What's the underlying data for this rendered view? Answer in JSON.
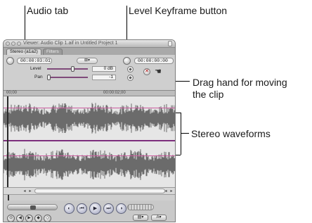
{
  "callouts": {
    "audio_tab": "Audio tab",
    "level_keyframe_button": "Level Keyframe button",
    "drag_hand_line1": "Drag hand for moving",
    "drag_hand_line2": "the clip",
    "stereo_waveforms": "Stereo waveforms"
  },
  "window": {
    "title": "Viewer: Audio Clip 1.aif in Untitled Project 1"
  },
  "tabs": [
    {
      "label": "Stereo (a1a2)",
      "active": true
    },
    {
      "label": "Filters",
      "active": false
    }
  ],
  "timecode": {
    "duration": "00:00:03:01",
    "current": "00:00:00:00"
  },
  "params": {
    "level": {
      "label": "Level",
      "value": "0",
      "unit": "dB"
    },
    "pan": {
      "label": "Pan",
      "value": "-1"
    }
  },
  "ruler": {
    "start": "00;00",
    "mid": "00:00:02;00"
  },
  "colors": {
    "waveform": "#6b6b6b",
    "level_line": "#cc5c9f",
    "channel_separator": "#7d2f7d"
  },
  "icons": {
    "close": "circle",
    "drag_hand": "hand",
    "play": "triangle-right"
  }
}
